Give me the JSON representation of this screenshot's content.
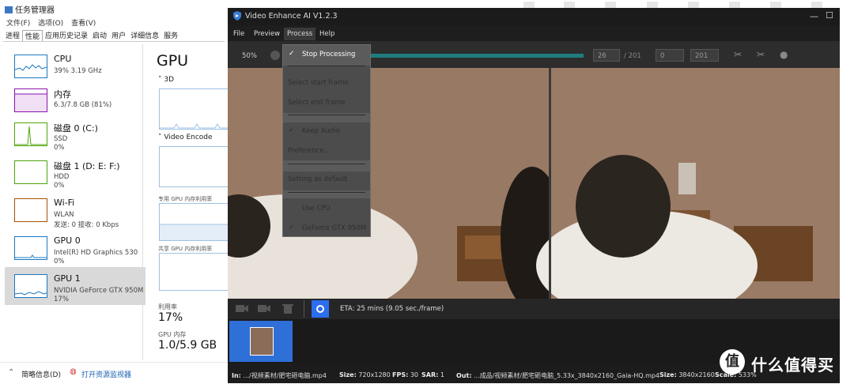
{
  "taskmgr": {
    "title": "任务管理器",
    "menu": [
      "文件(F)",
      "选项(O)",
      "查看(V)"
    ],
    "tabs": [
      "进程",
      "性能",
      "应用历史记录",
      "启动",
      "用户",
      "详细信息",
      "服务"
    ],
    "selected_tab": "性能",
    "resources": [
      {
        "name": "CPU",
        "s1": "39%  3.19 GHz",
        "s2": "",
        "color": "#1a78c2"
      },
      {
        "name": "内存",
        "s1": "6.3/7.8 GB (81%)",
        "s2": "",
        "color": "#8b12ae"
      },
      {
        "name": "磁盘 0 (C:)",
        "s1": "SSD",
        "s2": "0%",
        "color": "#4da60c"
      },
      {
        "name": "磁盘 1 (D: E: F:)",
        "s1": "HDD",
        "s2": "0%",
        "color": "#4da60c"
      },
      {
        "name": "Wi-Fi",
        "s1": "WLAN",
        "s2": "发送: 0 接收: 0 Kbps",
        "color": "#a74f01"
      },
      {
        "name": "GPU 0",
        "s1": "Intel(R) HD Graphics 530",
        "s2": "0%",
        "color": "#1a78c2"
      },
      {
        "name": "GPU 1",
        "s1": "NVIDIA GeForce GTX 950M",
        "s2": "17%",
        "color": "#1a78c2"
      }
    ],
    "main": {
      "heading": "GPU",
      "engine1": "3D",
      "engine2": "Video Encode",
      "dedicated_label": "专用 GPU 内存利用率",
      "shared_label": "共享 GPU 内存利用率",
      "util_label": "利用率",
      "util_value": "17%",
      "mem_label": "GPU 内存",
      "mem_value": "1.0/5.9 GB"
    },
    "footer": {
      "less": "简略信息(D)",
      "monitor": "打开资源监视器"
    }
  },
  "vea": {
    "title": "Video Enhance AI V1.2.3",
    "menu": [
      "File",
      "Preview",
      "Process",
      "Help"
    ],
    "open_menu": "Process",
    "zoom": "50%",
    "frame_current": "26",
    "frame_total": "/ 201",
    "range_start": "0",
    "range_end": "201",
    "eta": "ETA:  25 mins  (9.05 sec./frame)",
    "process_menu": [
      {
        "label": "Stop Processing",
        "checked": true,
        "enabled": true
      },
      {
        "label": "Select start frame",
        "checked": false,
        "enabled": false
      },
      {
        "label": "Select end frame",
        "checked": false,
        "enabled": false
      },
      {
        "label": "Keep Audio",
        "checked": true,
        "enabled": false
      },
      {
        "label": "Preference...",
        "checked": false,
        "enabled": false
      },
      {
        "label": "Setting as default",
        "checked": false,
        "enabled": false
      },
      {
        "label": "Use CPU",
        "checked": false,
        "enabled": false
      },
      {
        "label": "GeForce GTX 950M",
        "checked": true,
        "enabled": false
      }
    ],
    "info": {
      "in_label": "In:",
      "in_value": ".../视频素材/肥宅砸电脑.mp4",
      "size_label": "Size:",
      "size_value": "720x1280",
      "fps_label": "FPS:",
      "fps_value": "30",
      "sar_label": "SAR:",
      "sar_value": "1",
      "out_label": "Out:",
      "out_value": "...成品/视频素材/肥宅砸电脑_5.33x_3840x2160_Gaia-HQ.mp4",
      "size2_label": "Size:",
      "size2_value": "3840x2160",
      "scale_label": "Scale:",
      "scale_value": "533%"
    }
  },
  "watermark": {
    "glyph": "值",
    "text": "什么值得买"
  }
}
